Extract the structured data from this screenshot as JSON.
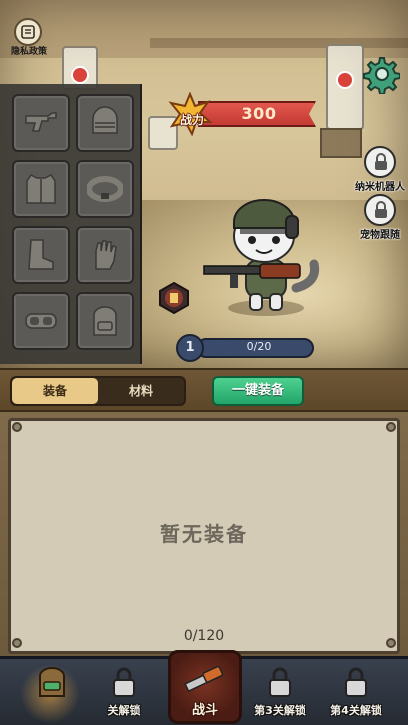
{
  "privacy": {
    "label": "隐私政策",
    "icon": "document-icon"
  },
  "power": {
    "label": "战力",
    "value": "300"
  },
  "side_buttons": [
    {
      "label": "纳米机器人",
      "icon": "lock-icon"
    },
    {
      "label": "宠物跟随",
      "icon": "lock-icon"
    }
  ],
  "equipment_slots": [
    {
      "icon": "revolver-icon"
    },
    {
      "icon": "helmet-icon"
    },
    {
      "icon": "vest-icon"
    },
    {
      "icon": "belt-icon"
    },
    {
      "icon": "boot-icon"
    },
    {
      "icon": "glove-icon"
    },
    {
      "icon": "goggles-icon"
    },
    {
      "icon": "backpack-icon"
    }
  ],
  "level": {
    "value": "1",
    "progress": "0/20"
  },
  "tabs": [
    {
      "label": "装备",
      "active": true
    },
    {
      "label": "材料",
      "active": false
    }
  ],
  "one_key_equip": "一键装备",
  "inventory": {
    "empty_text": "暂无装备",
    "count": "0/120"
  },
  "bottom_nav": [
    {
      "label": "",
      "icon": "backpack-icon",
      "active": true
    },
    {
      "label": "关解锁",
      "icon": "lock-icon"
    },
    {
      "label": "战斗",
      "icon": "gun-icon"
    },
    {
      "label": "第3关解锁",
      "icon": "lock-icon"
    },
    {
      "label": "第4关解锁",
      "icon": "lock-icon"
    }
  ],
  "colors": {
    "power_red": "#c23a33",
    "tab_active": "#e8c987",
    "button_green": "#23a56a",
    "level_blue": "#394a6a"
  }
}
